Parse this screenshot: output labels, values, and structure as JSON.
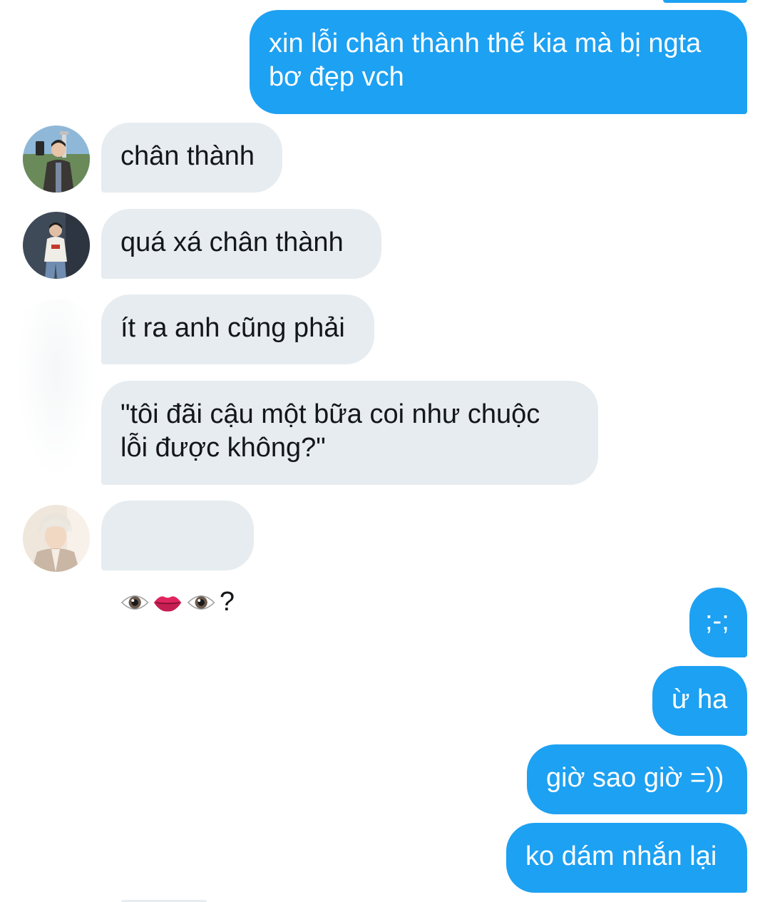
{
  "conversation": {
    "messages": [
      {
        "from": "me",
        "text": "xin lỗi chân thành thế kia mà bị ngta\nbơ đẹp vch"
      },
      {
        "from": "other",
        "avatar": "avatar-1",
        "text": "chân thành"
      },
      {
        "from": "other",
        "avatar": "avatar-2",
        "text": "quá xá chân thành"
      },
      {
        "from": "other",
        "avatar": null,
        "text": "ít ra anh cũng phải"
      },
      {
        "from": "other",
        "avatar": null,
        "text": "\"tôi đãi cậu một bữa coi như chuộc\nlỗi được không?\""
      },
      {
        "from": "other",
        "avatar": "avatar-3",
        "emoji": [
          "eye-icon",
          "lips-icon",
          "eye-icon"
        ],
        "text": "?"
      },
      {
        "from": "me",
        "text": ";-;"
      },
      {
        "from": "me",
        "text": "ừ ha"
      },
      {
        "from": "me",
        "text": "giờ sao giờ =))"
      },
      {
        "from": "me",
        "text": "ko dám nhắn lại"
      }
    ]
  },
  "colors": {
    "sent_bubble": "#1da1f2",
    "received_bubble": "#e6ecf0",
    "received_text": "#14171a",
    "sent_text": "#ffffff"
  }
}
